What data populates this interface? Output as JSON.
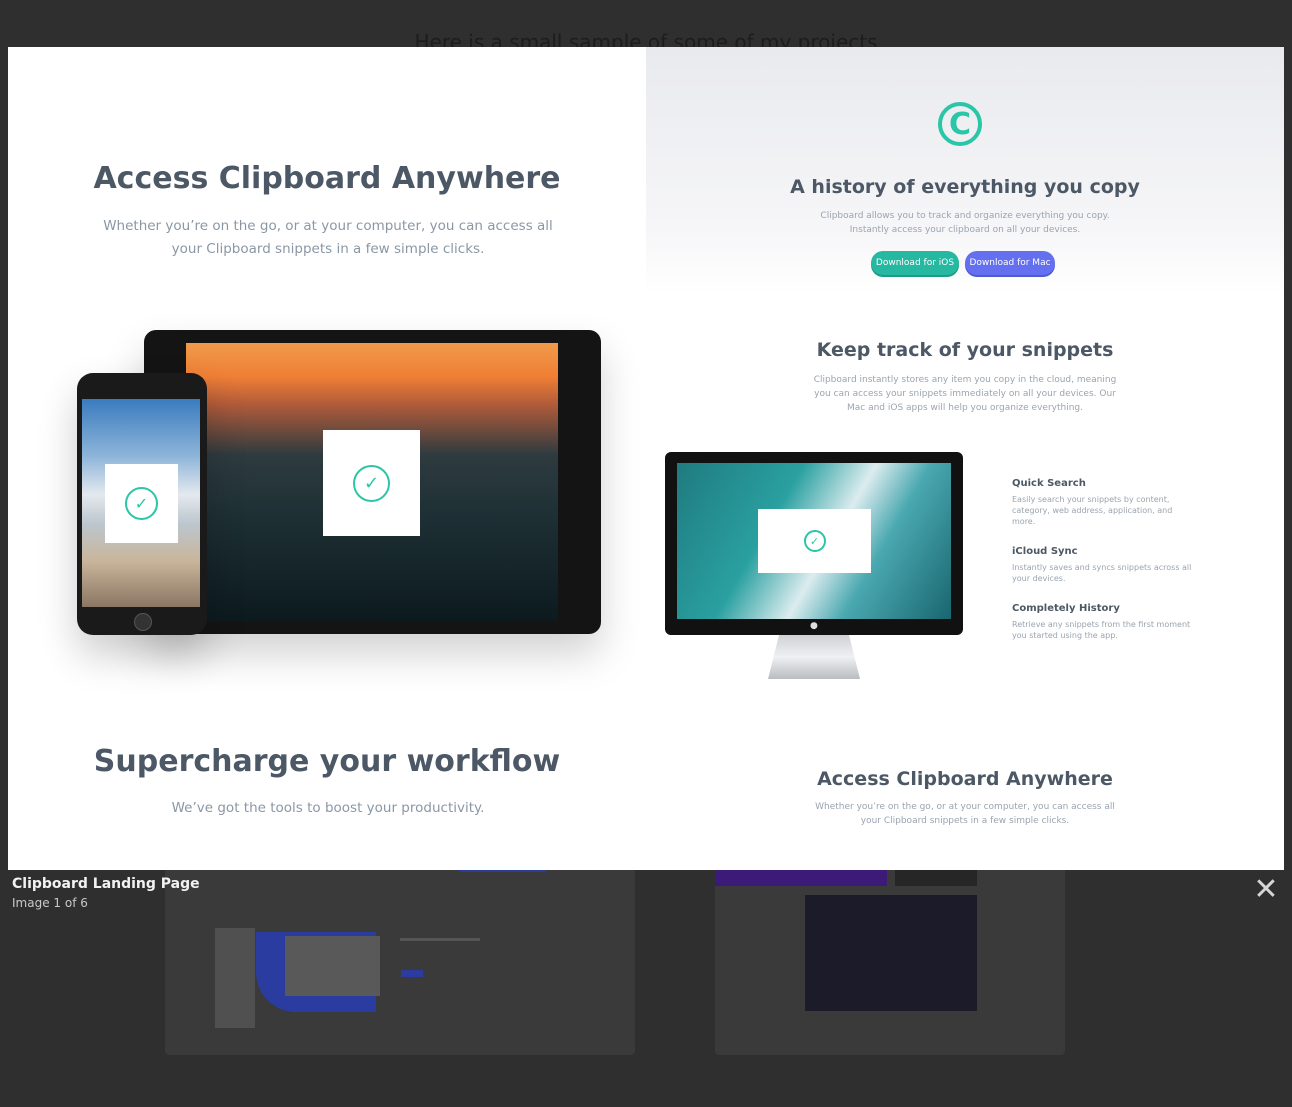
{
  "background": {
    "subtitle": "Here is a small sample of some of my projects"
  },
  "lightbox": {
    "left_column": {
      "heading": "Access Clipboard Anywhere",
      "text": "Whether you’re on the go, or at your computer, you can access all your Clipboard snippets in a few simple clicks.",
      "heading2": "Supercharge your workflow",
      "text2": "We’ve got the tools to boost your productivity."
    },
    "right_column": {
      "hero_heading": "A history of everything you copy",
      "hero_text": "Clipboard allows you to track and organize everything you copy. Instantly access your clipboard on all your devices.",
      "btn_ios": "Download for iOS",
      "btn_mac": "Download for Mac",
      "section_heading": "Keep track of your snippets",
      "section_text": "Clipboard instantly stores any item you copy in the cloud, meaning you can access your snippets immediately on all your devices. Our Mac and iOS apps will help you organize everything.",
      "features": [
        {
          "title": "Quick Search",
          "desc": "Easily search your snippets by content, category, web address, application, and more."
        },
        {
          "title": "iCloud Sync",
          "desc": "Instantly saves and syncs snippets across all your devices."
        },
        {
          "title": "Completely History",
          "desc": "Retrieve any snippets from the first moment you started using the app."
        }
      ],
      "bottom_heading": "Access Clipboard Anywhere",
      "bottom_text": "Whether you’re on the go, or at your computer, you can access all your Clipboard snippets in a few simple clicks."
    }
  },
  "caption": {
    "title": "Clipboard Landing Page",
    "counter": "Image 1 of 6"
  },
  "icons": {
    "close": "close-icon",
    "logo": "copyright-logo-icon",
    "check": "check-circle-icon"
  },
  "colors": {
    "accent_teal": "#2bc5a7",
    "accent_purple": "#6470f0",
    "overlay_bg": "#2f2f2f"
  }
}
